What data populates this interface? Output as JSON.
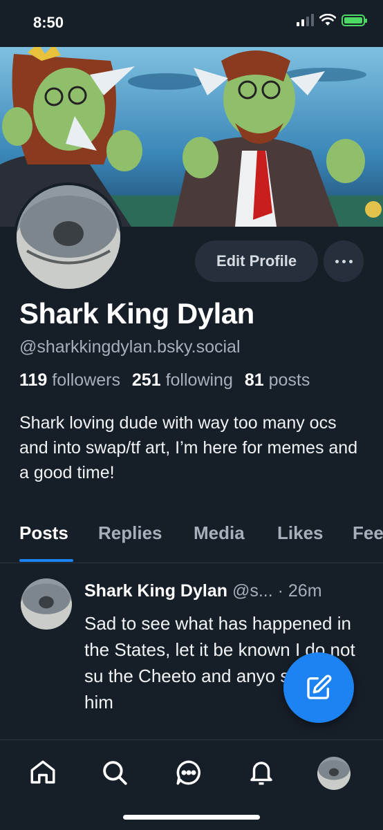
{
  "status_bar": {
    "time": "8:50"
  },
  "profile": {
    "display_name": "Shark King Dylan",
    "handle": "@sharkkingdylan.bsky.social",
    "followers_count": "119",
    "followers_label": "followers",
    "following_count": "251",
    "following_label": "following",
    "posts_count": "81",
    "posts_label": "posts",
    "bio": "Shark loving dude with way too many ocs and into swap/tf art, I’m here for memes and a good time!"
  },
  "actions": {
    "edit_label": "Edit Profile",
    "more_label": "···"
  },
  "tabs": [
    {
      "label": "Posts",
      "active": true
    },
    {
      "label": "Replies"
    },
    {
      "label": "Media"
    },
    {
      "label": "Likes"
    },
    {
      "label": "Fee"
    }
  ],
  "post": {
    "author": "Shark King Dylan",
    "handle": "@s...",
    "time": "· 26m",
    "text": "Sad to see what has happened in the States, let it be known I do not su the Cheeto and anyo supports him"
  },
  "nav": {
    "icons": [
      "home-icon",
      "search-icon",
      "chat-icon",
      "bell-icon",
      "avatar"
    ]
  },
  "colors": {
    "accent": "#1d83f3",
    "background": "#161e27",
    "battery": "#4cd964"
  }
}
